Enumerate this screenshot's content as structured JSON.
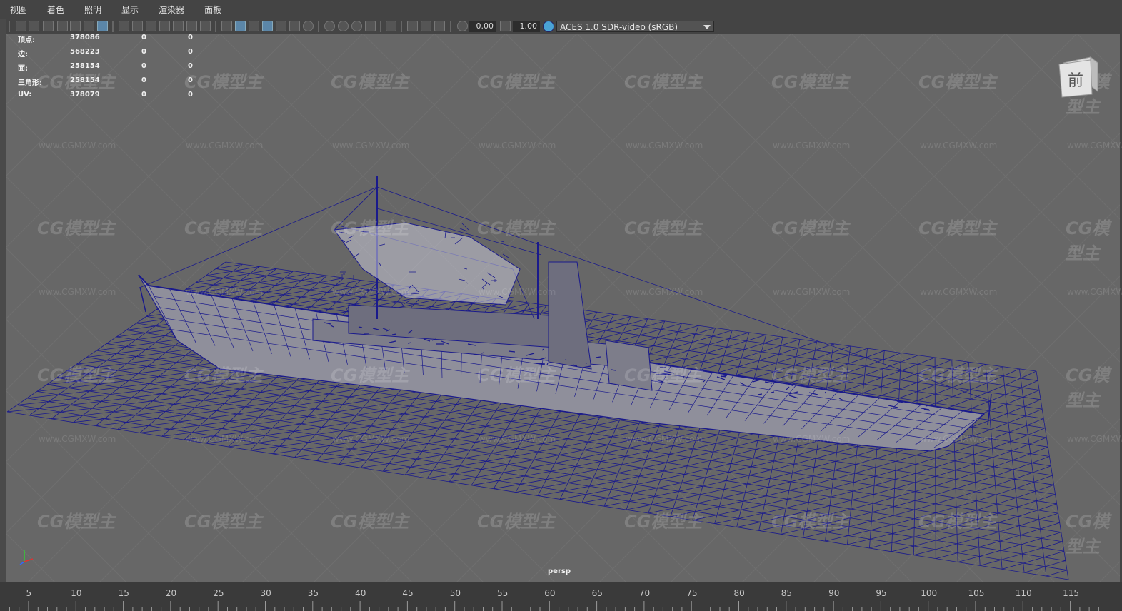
{
  "menu": [
    "视图",
    "着色",
    "照明",
    "显示",
    "渲染器",
    "面板"
  ],
  "toolbar": {
    "exposure_value": "0.00",
    "gamma_value": "1.00",
    "color_space": "ACES 1.0 SDR-video (sRGB)"
  },
  "hud": {
    "rows": [
      {
        "label": "顶点:",
        "value": "378086",
        "c2": "0",
        "c3": "0"
      },
      {
        "label": "边:",
        "value": "568223",
        "c2": "0",
        "c3": "0"
      },
      {
        "label": "面:",
        "value": "258154",
        "c2": "0",
        "c3": "0"
      },
      {
        "label": "三角形:",
        "value": "258154",
        "c2": "0",
        "c3": "0"
      },
      {
        "label": "UV:",
        "value": "378079",
        "c2": "0",
        "c3": "0"
      }
    ]
  },
  "viewport": {
    "camera": "persp",
    "view_cube_face": "前",
    "wireframe_color": "#1a1a8c",
    "background_color": "#676767"
  },
  "watermark": {
    "logo": "CG模型主",
    "url": "www.CGMXW.com"
  },
  "timeline": {
    "ticks": [
      "5",
      "10",
      "15",
      "20",
      "25",
      "30",
      "35",
      "40",
      "45",
      "50",
      "55",
      "60",
      "65",
      "70",
      "75",
      "80",
      "85",
      "90",
      "95",
      "100",
      "105",
      "110",
      "115"
    ]
  }
}
